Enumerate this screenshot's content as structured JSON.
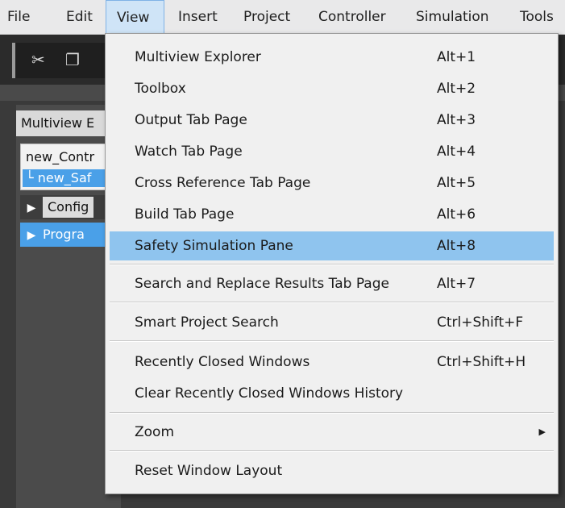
{
  "menubar": {
    "items": [
      {
        "label": "File"
      },
      {
        "label": "Edit"
      },
      {
        "label": "View"
      },
      {
        "label": "Insert"
      },
      {
        "label": "Project"
      },
      {
        "label": "Controller"
      },
      {
        "label": "Simulation"
      },
      {
        "label": "Tools"
      }
    ],
    "active": "View"
  },
  "toolbar": {
    "icons": [
      "cut-icon",
      "copy-icon"
    ]
  },
  "panel": {
    "title": "Multiview E",
    "controller_label": "new_Contr",
    "safety_label": "└ new_Saf",
    "config_label": "Config",
    "program_label": "Progra"
  },
  "view_menu": {
    "items": [
      {
        "label": "Multiview Explorer",
        "shortcut": "Alt+1"
      },
      {
        "label": "Toolbox",
        "shortcut": "Alt+2"
      },
      {
        "label": "Output Tab Page",
        "shortcut": "Alt+3"
      },
      {
        "label": "Watch Tab Page",
        "shortcut": "Alt+4"
      },
      {
        "label": "Cross Reference Tab Page",
        "shortcut": "Alt+5"
      },
      {
        "label": "Build Tab Page",
        "shortcut": "Alt+6"
      },
      {
        "label": "Safety Simulation Pane",
        "shortcut": "Alt+8"
      },
      {
        "label": "Search and Replace Results Tab Page",
        "shortcut": "Alt+7"
      },
      {
        "label": "Smart Project Search",
        "shortcut": "Ctrl+Shift+F"
      },
      {
        "label": "Recently Closed Windows",
        "shortcut": "Ctrl+Shift+H"
      },
      {
        "label": "Clear Recently Closed Windows History",
        "shortcut": ""
      },
      {
        "label": "Zoom",
        "shortcut": ""
      },
      {
        "label": "Reset Window Layout",
        "shortcut": ""
      }
    ],
    "highlighted": "Safety Simulation Pane",
    "colors": {
      "highlight": "#8fc4ee",
      "menu_bg": "#f0f0f0",
      "accent_blue": "#4aa0e8"
    }
  }
}
